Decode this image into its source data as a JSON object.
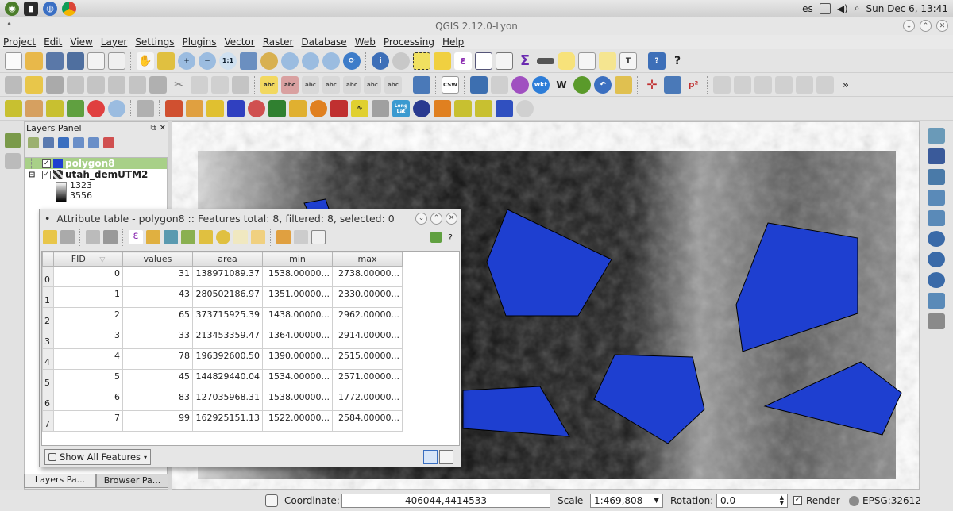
{
  "system_bar": {
    "keyboard_layout": "es",
    "datetime": "Sun Dec  6, 13:41"
  },
  "window": {
    "title": "QGIS 2.12.0-Lyon"
  },
  "menu": [
    "Project",
    "Edit",
    "View",
    "Layer",
    "Settings",
    "Plugins",
    "Vector",
    "Raster",
    "Database",
    "Web",
    "Processing",
    "Help"
  ],
  "toolbar_labels": {
    "csw": "CSW",
    "wkt": "wkt",
    "p2": "p²",
    "longlat": "Long Lat"
  },
  "layers_panel": {
    "title": "Layers Panel",
    "layers": [
      {
        "name": "polygon8",
        "checked": true,
        "selected": true,
        "color": "#1e3fd0"
      },
      {
        "name": "utah_demUTM2",
        "checked": true,
        "selected": false
      }
    ],
    "legend": [
      {
        "label": "1323",
        "color": "#ffffff"
      },
      {
        "label": "3556",
        "color": "#000000"
      }
    ],
    "tabs": [
      "Layers Pa...",
      "Browser Pa..."
    ]
  },
  "attribute_table": {
    "title": "Attribute table - polygon8 :: Features total: 8, filtered: 8, selected: 0",
    "columns": [
      "FID",
      "values",
      "area",
      "min",
      "max"
    ],
    "rows": [
      [
        "0",
        "31",
        "138971089.37",
        "1538.00000...",
        "2738.00000..."
      ],
      [
        "1",
        "43",
        "280502186.97",
        "1351.00000...",
        "2330.00000..."
      ],
      [
        "2",
        "65",
        "373715925.39",
        "1438.00000...",
        "2962.00000..."
      ],
      [
        "3",
        "33",
        "213453359.47",
        "1364.00000...",
        "2914.00000..."
      ],
      [
        "4",
        "78",
        "196392600.50",
        "1390.00000...",
        "2515.00000..."
      ],
      [
        "5",
        "45",
        "144829440.04",
        "1534.00000...",
        "2571.00000..."
      ],
      [
        "6",
        "83",
        "127035968.31",
        "1538.00000...",
        "1772.00000..."
      ],
      [
        "7",
        "99",
        "162925151.13",
        "1522.00000...",
        "2584.00000..."
      ]
    ],
    "row_headers": [
      "0",
      "1",
      "2",
      "3",
      "4",
      "5",
      "6",
      "7"
    ],
    "show_features_button": "Show All Features"
  },
  "statusbar": {
    "coordinate_label": "Coordinate:",
    "coordinate_value": "406044,4414533",
    "scale_label": "Scale",
    "scale_value": "1:469,808",
    "rotation_label": "Rotation:",
    "rotation_value": "0.0",
    "render_label": "Render",
    "crs": "EPSG:32612"
  },
  "colors": {
    "polygon_fill": "#1e3fd0",
    "selection_green": "#a8d088",
    "toolbar_bg": "#e4e4e4"
  }
}
